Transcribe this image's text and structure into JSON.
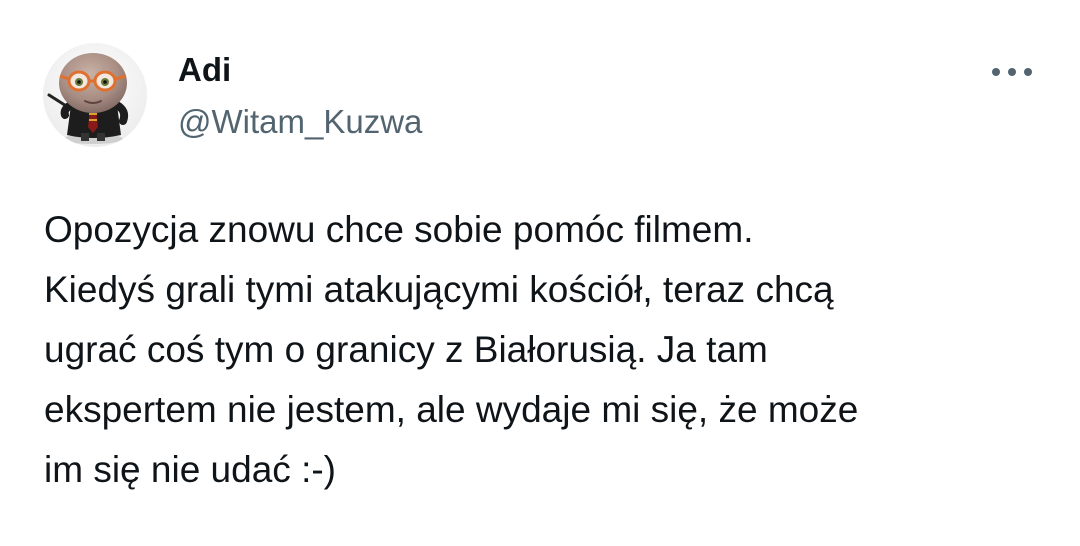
{
  "tweet": {
    "author": {
      "display_name": "Adi",
      "handle": "@Witam_Kuzwa"
    },
    "text": "Opozycja znowu chce sobie pomóc filmem.\nKiedyś grali tymi atakującymi kościół, teraz chcą\nugrać coś tym o granicy z Białorusią. Ja tam\nekspertem nie jestem, ale wydaje mi się, że może\nim się nie udać :-)",
    "more_icon": "more-horizontal-icon"
  },
  "colors": {
    "primary_text": "#0f1419",
    "secondary_text": "#536471",
    "background": "#ffffff"
  }
}
